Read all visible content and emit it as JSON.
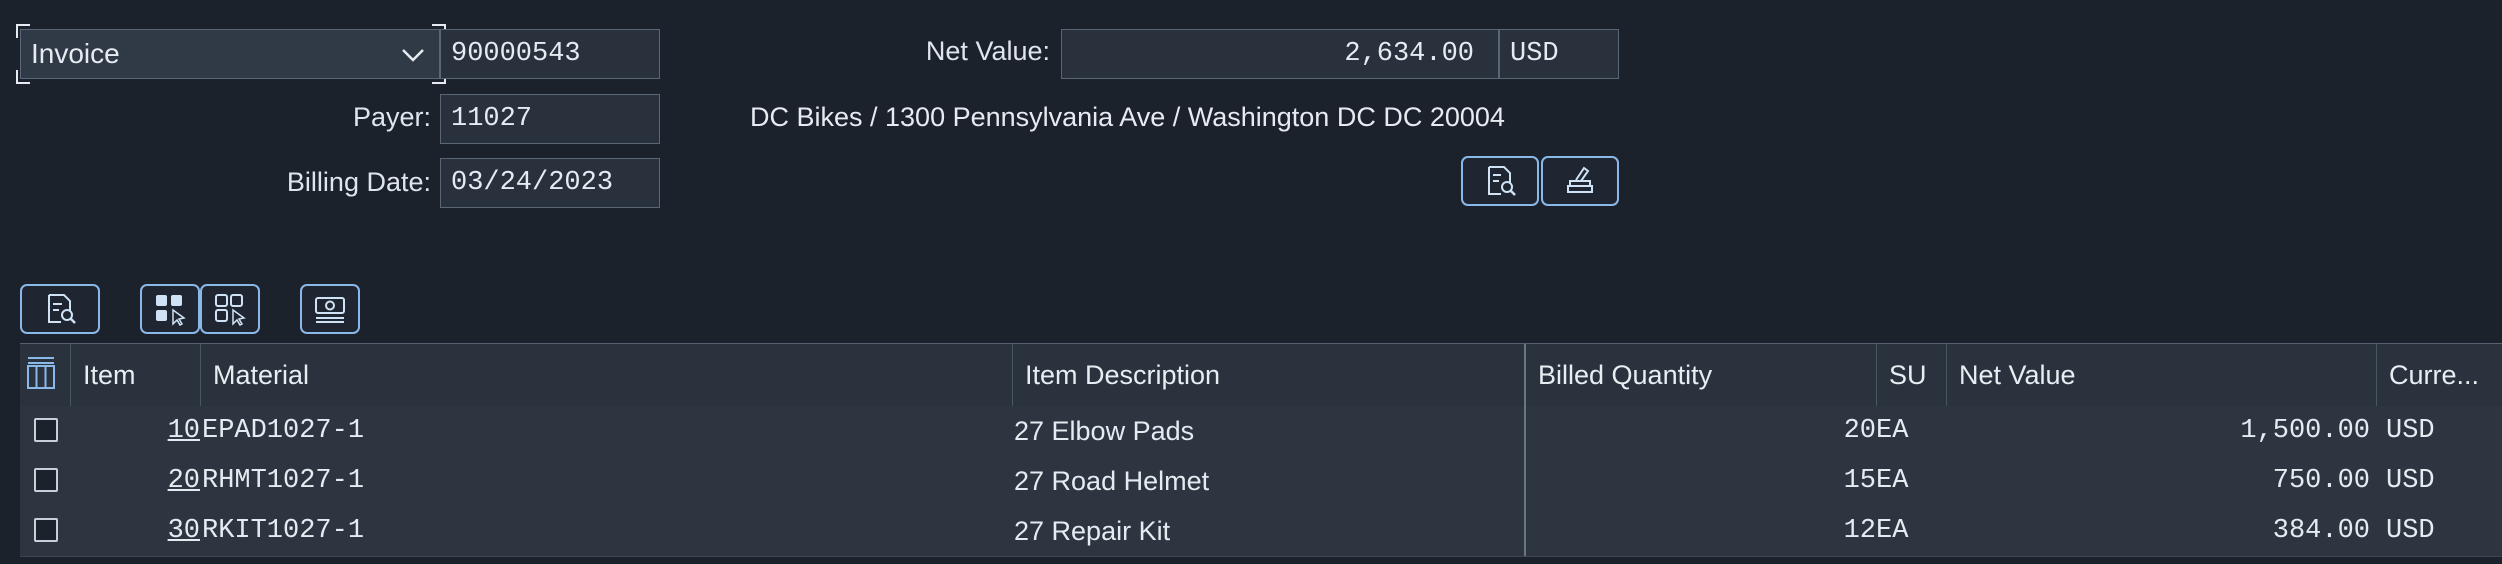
{
  "header": {
    "doc_type": "Invoice",
    "doc_number": "90000543",
    "net_value_label": "Net Value:",
    "net_value": "2,634.00",
    "currency": "USD",
    "payer_label": "Payer:",
    "payer": "11027",
    "payer_address": "DC Bikes / 1300 Pennsylvania Ave / Washington DC DC 20004",
    "billing_date_label": "Billing Date:",
    "billing_date": "03/24/2023"
  },
  "table": {
    "columns": [
      "Item",
      "Material",
      "Item Description",
      "Billed Quantity",
      "SU",
      "Net Value",
      "Curre..."
    ],
    "rows": [
      {
        "item": "10",
        "material": "EPAD1027-1",
        "description": "27 Elbow Pads",
        "qty": "20",
        "su": "EA",
        "net": "1,500.00",
        "curr": "USD"
      },
      {
        "item": "20",
        "material": "RHMT1027-1",
        "description": "27 Road Helmet",
        "qty": "15",
        "su": "EA",
        "net": "750.00",
        "curr": "USD"
      },
      {
        "item": "30",
        "material": "RKIT1027-1",
        "description": "27 Repair Kit",
        "qty": "12",
        "su": "EA",
        "net": "384.00",
        "curr": "USD"
      }
    ]
  },
  "icons": {
    "header_buttons": [
      "document-search-icon",
      "clear-icon"
    ],
    "toolbar": [
      "details-icon",
      "select-all-icon",
      "deselect-all-icon",
      "pricing-icon"
    ],
    "table": [
      "column-settings-icon"
    ]
  },
  "colors": {
    "accent": "#8ab8e8",
    "background": "#1c222b"
  }
}
